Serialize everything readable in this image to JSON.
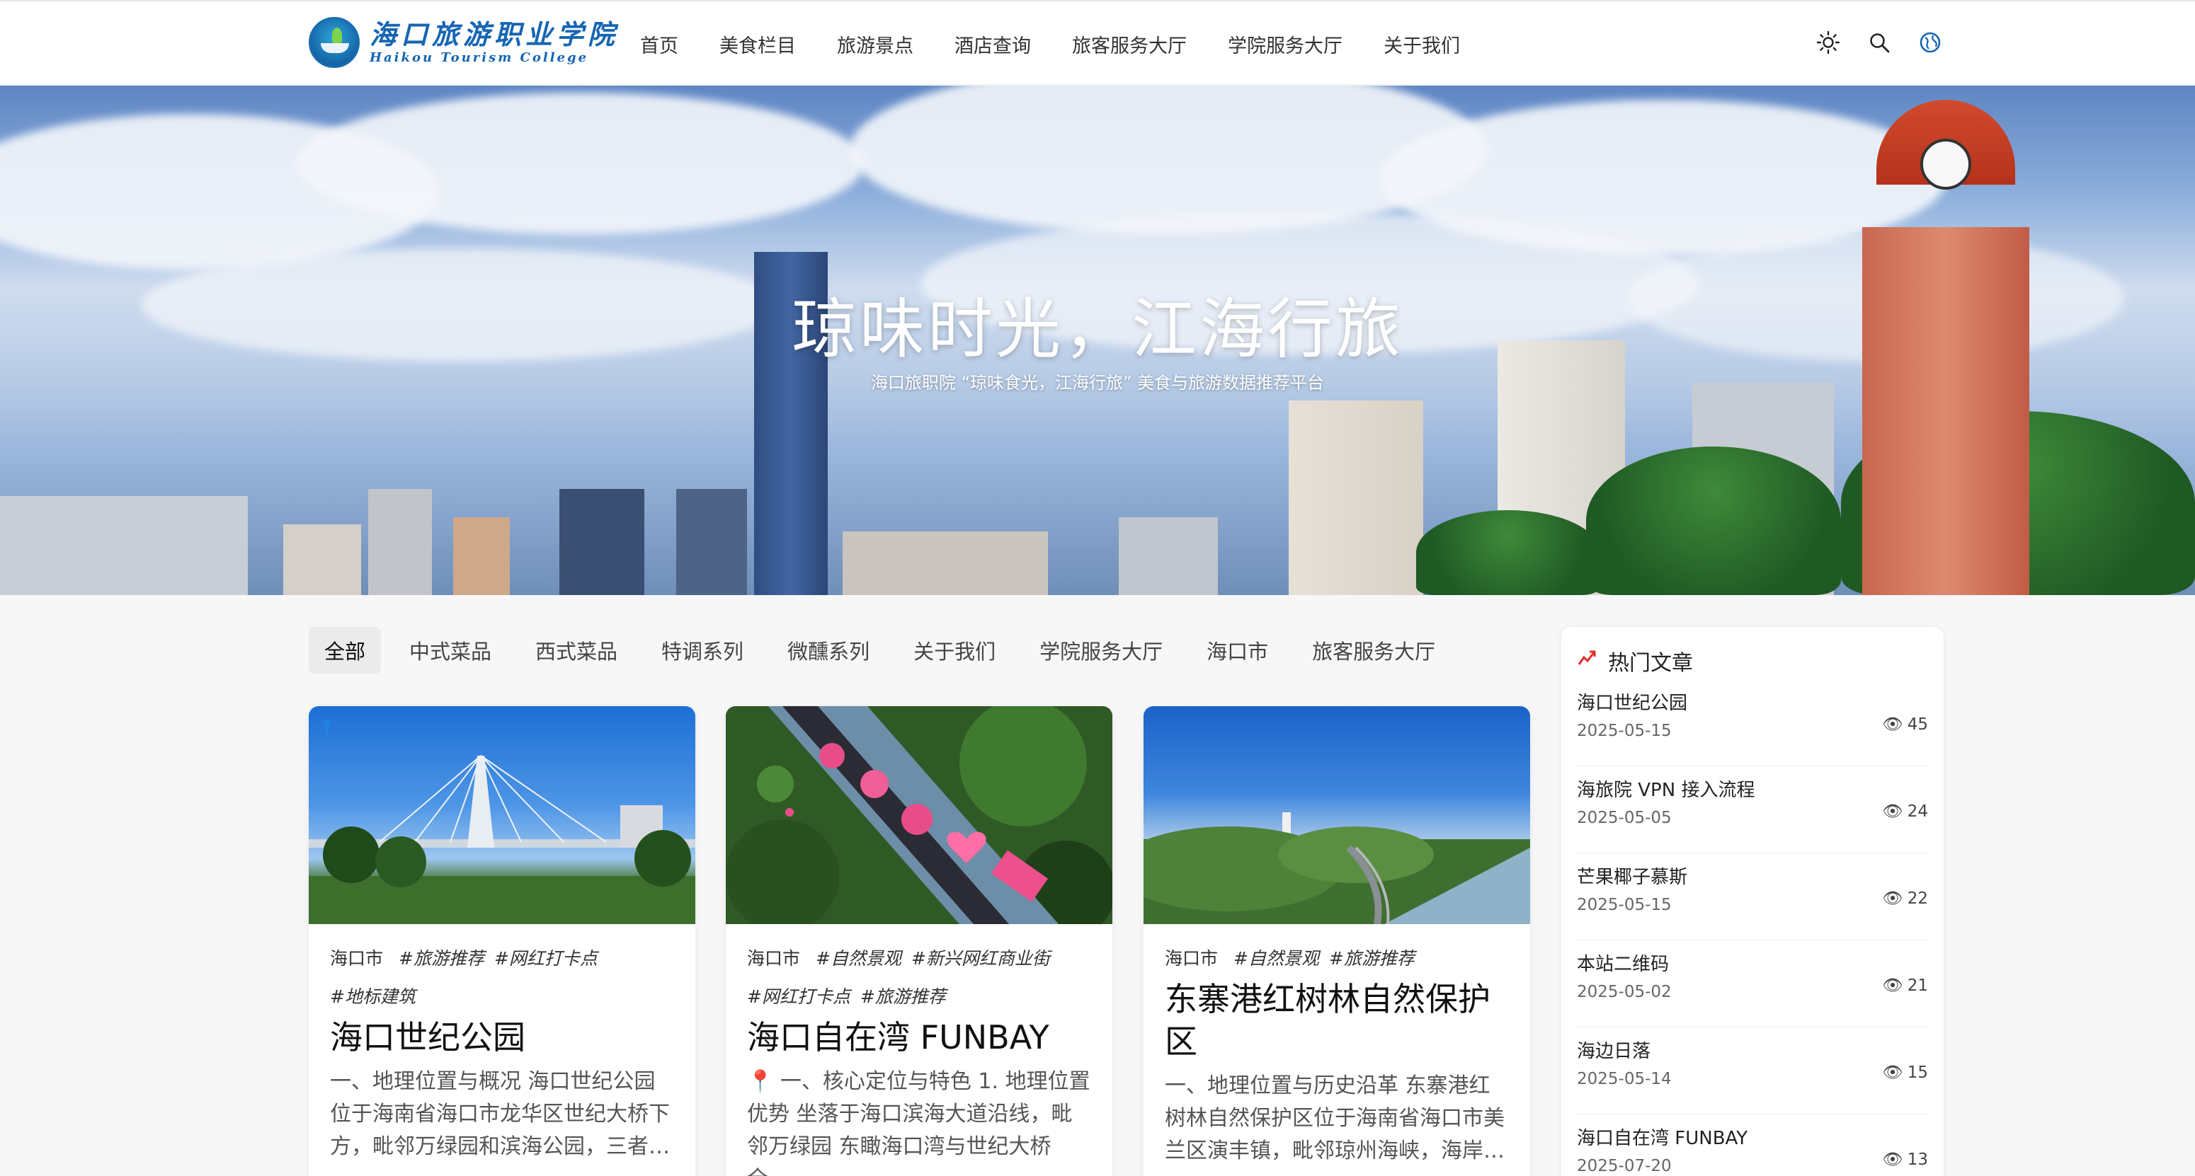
{
  "header": {
    "logo_cn": "海口旅游职业学院",
    "logo_en": "Haikou Tourism College",
    "nav": [
      "首页",
      "美食栏目",
      "旅游景点",
      "酒店查询",
      "旅客服务大厅",
      "学院服务大厅",
      "关于我们"
    ],
    "icons": [
      "sun-icon",
      "search-icon",
      "globe-icon"
    ]
  },
  "hero": {
    "title": "琼味时光，江海行旅",
    "subtitle": "海口旅职院 “琼味食光，江海行旅” 美食与旅游数据推荐平台"
  },
  "tabs": [
    "全部",
    "中式菜品",
    "西式菜品",
    "特调系列",
    "微醺系列",
    "关于我们",
    "学院服务大厅",
    "海口市",
    "旅客服务大厅"
  ],
  "active_tab": "全部",
  "cards": [
    {
      "city": "海口市",
      "tags": [
        "#旅游推荐",
        "#网红打卡点",
        "#地标建筑"
      ],
      "title": "海口世纪公园",
      "excerpt": "一、地理位置与概况 海口世纪公园位于海南省海口市龙华区世纪大桥下方，毗邻万绿园和滨海公园，三者…"
    },
    {
      "city": "海口市",
      "tags": [
        "#自然景观",
        "#新兴网红商业街",
        "#网红打卡点",
        "#旅游推荐"
      ],
      "title": "海口自在湾 FUNBAY",
      "excerpt": "📍 一、核心定位与特色 1. 地理位置优势 坐落于海口滨海大道沿线，毗邻万绿园 东瞰海口湾与世纪大桥全…"
    },
    {
      "city": "海口市",
      "tags": [
        "#自然景观",
        "#旅游推荐"
      ],
      "title": "东寨港红树林自然保护区",
      "excerpt": "一、地理位置与历史沿革 东寨港红树林自然保护区位于海南省海口市美兰区演丰镇，毗邻琼州海峡，海岸…"
    }
  ],
  "sidebar": {
    "title": "热门文章",
    "items": [
      {
        "title": "海口世纪公园",
        "date": "2025-05-15",
        "views": "45"
      },
      {
        "title": "海旅院 VPN 接入流程",
        "date": "2025-05-05",
        "views": "24"
      },
      {
        "title": "芒果椰子慕斯",
        "date": "2025-05-15",
        "views": "22"
      },
      {
        "title": "本站二维码",
        "date": "2025-05-02",
        "views": "21"
      },
      {
        "title": "海边日落",
        "date": "2025-05-14",
        "views": "15"
      },
      {
        "title": "海口自在湾 FUNBAY",
        "date": "2025-07-20",
        "views": "13"
      }
    ]
  },
  "colors": {
    "brand": "#1565b3",
    "hot_icon": "#e02b2b"
  }
}
